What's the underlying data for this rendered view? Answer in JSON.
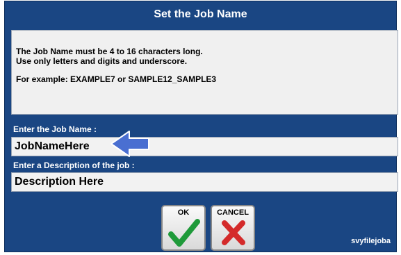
{
  "dialog": {
    "title": "Set the Job Name",
    "info_line1": "The Job Name must be 4 to 16 characters long.",
    "info_line2": "Use only letters and digits and underscore.",
    "info_example": "For example: EXAMPLE7  or  SAMPLE12_SAMPLE3",
    "job_name_label": "Enter the Job Name :",
    "job_name_value": "JobNameHere",
    "description_label": "Enter a Description of the job :",
    "description_value": "Description Here",
    "ok_label": "OK",
    "cancel_label": "CANCEL",
    "footer_id": "svyfilejoba"
  },
  "colors": {
    "background": "#1a4683",
    "ok_check": "#1f9a3a",
    "cancel_x": "#d42a2a",
    "cursor": "#4a6fd1"
  },
  "icons": [
    "check-icon",
    "x-icon",
    "pointer-hand-icon"
  ]
}
